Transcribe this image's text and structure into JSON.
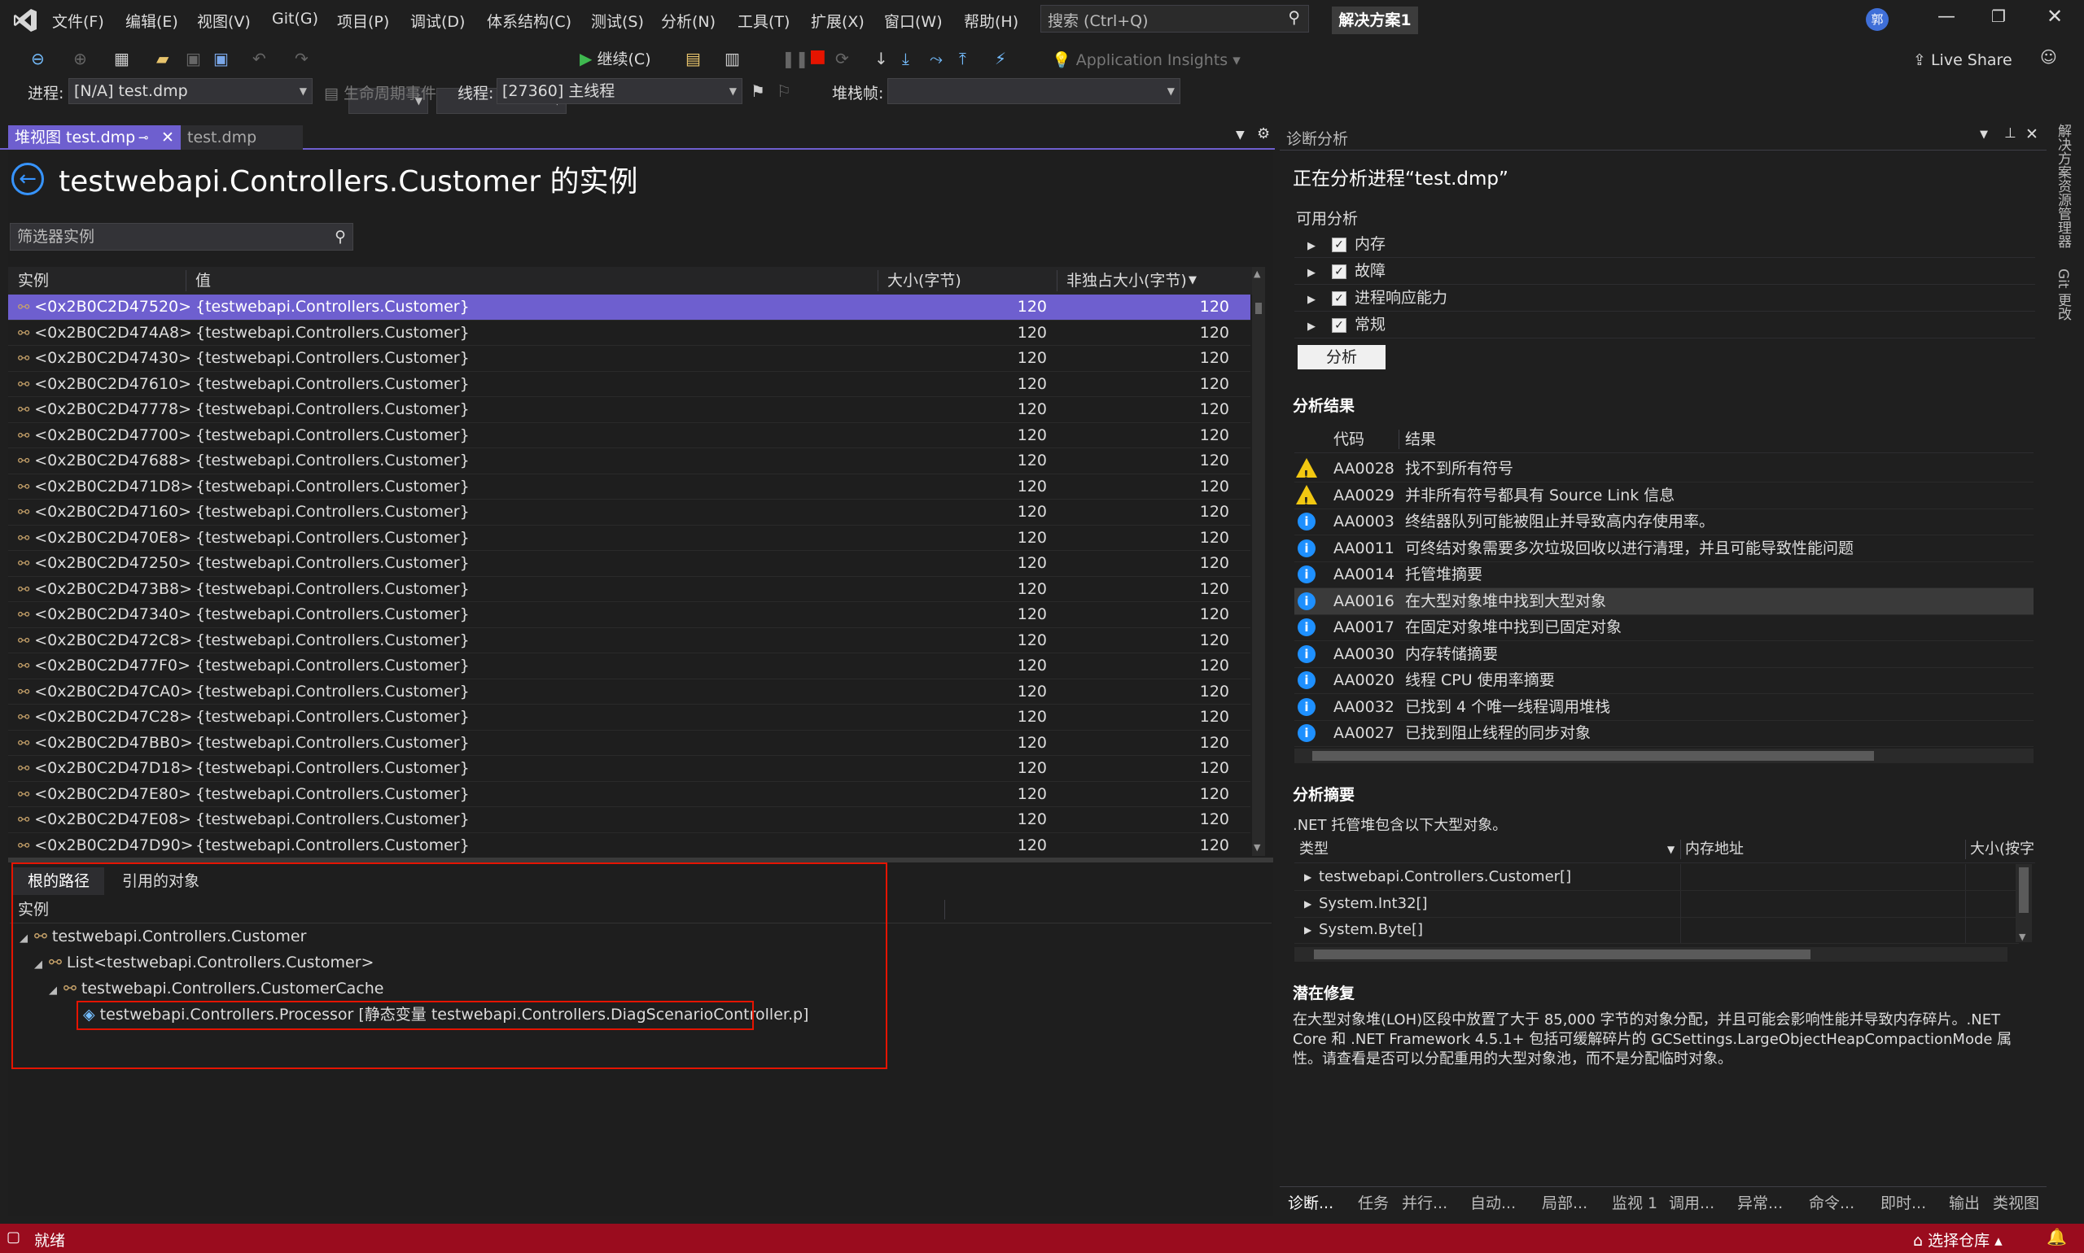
{
  "menu": [
    "文件(F)",
    "编辑(E)",
    "视图(V)",
    "Git(G)",
    "项目(P)",
    "调试(D)",
    "体系结构(C)",
    "测试(S)",
    "分析(N)",
    "工具(T)",
    "扩展(X)",
    "窗口(W)",
    "帮助(H)"
  ],
  "search": {
    "placeholder": "搜索 (Ctrl+Q)"
  },
  "solution_name": "解决方案1",
  "user_avatar": "郭",
  "toolbar": {
    "continue_label": "继续(C)",
    "app_insights": "Application Insights",
    "live_share": "Live Share"
  },
  "debug_location": {
    "process_label": "进程:",
    "process_value": "[N/A] test.dmp",
    "lifecycle_label": "生命周期事件",
    "thread_label": "线程:",
    "thread_value": "[27360] 主线程",
    "stack_label": "堆栈帧:"
  },
  "doc_tabs": [
    {
      "label": "堆视图 test.dmp",
      "active": true
    },
    {
      "label": "test.dmp",
      "active": false
    }
  ],
  "heap_view": {
    "title": "testwebapi.Controllers.Customer 的实例",
    "filter_placeholder": "筛选器实例",
    "columns": [
      "实例",
      "值",
      "大小(字节)",
      "非独占大小(字节)"
    ],
    "rows": [
      {
        "instance": "<0x2B0C2D47520>",
        "value": "{testwebapi.Controllers.Customer}",
        "size": "120",
        "inclusive": "120"
      },
      {
        "instance": "<0x2B0C2D474A8>",
        "value": "{testwebapi.Controllers.Customer}",
        "size": "120",
        "inclusive": "120"
      },
      {
        "instance": "<0x2B0C2D47430>",
        "value": "{testwebapi.Controllers.Customer}",
        "size": "120",
        "inclusive": "120"
      },
      {
        "instance": "<0x2B0C2D47610>",
        "value": "{testwebapi.Controllers.Customer}",
        "size": "120",
        "inclusive": "120"
      },
      {
        "instance": "<0x2B0C2D47778>",
        "value": "{testwebapi.Controllers.Customer}",
        "size": "120",
        "inclusive": "120"
      },
      {
        "instance": "<0x2B0C2D47700>",
        "value": "{testwebapi.Controllers.Customer}",
        "size": "120",
        "inclusive": "120"
      },
      {
        "instance": "<0x2B0C2D47688>",
        "value": "{testwebapi.Controllers.Customer}",
        "size": "120",
        "inclusive": "120"
      },
      {
        "instance": "<0x2B0C2D471D8>",
        "value": "{testwebapi.Controllers.Customer}",
        "size": "120",
        "inclusive": "120"
      },
      {
        "instance": "<0x2B0C2D47160>",
        "value": "{testwebapi.Controllers.Customer}",
        "size": "120",
        "inclusive": "120"
      },
      {
        "instance": "<0x2B0C2D470E8>",
        "value": "{testwebapi.Controllers.Customer}",
        "size": "120",
        "inclusive": "120"
      },
      {
        "instance": "<0x2B0C2D47250>",
        "value": "{testwebapi.Controllers.Customer}",
        "size": "120",
        "inclusive": "120"
      },
      {
        "instance": "<0x2B0C2D473B8>",
        "value": "{testwebapi.Controllers.Customer}",
        "size": "120",
        "inclusive": "120"
      },
      {
        "instance": "<0x2B0C2D47340>",
        "value": "{testwebapi.Controllers.Customer}",
        "size": "120",
        "inclusive": "120"
      },
      {
        "instance": "<0x2B0C2D472C8>",
        "value": "{testwebapi.Controllers.Customer}",
        "size": "120",
        "inclusive": "120"
      },
      {
        "instance": "<0x2B0C2D477F0>",
        "value": "{testwebapi.Controllers.Customer}",
        "size": "120",
        "inclusive": "120"
      },
      {
        "instance": "<0x2B0C2D47CA0>",
        "value": "{testwebapi.Controllers.Customer}",
        "size": "120",
        "inclusive": "120"
      },
      {
        "instance": "<0x2B0C2D47C28>",
        "value": "{testwebapi.Controllers.Customer}",
        "size": "120",
        "inclusive": "120"
      },
      {
        "instance": "<0x2B0C2D47BB0>",
        "value": "{testwebapi.Controllers.Customer}",
        "size": "120",
        "inclusive": "120"
      },
      {
        "instance": "<0x2B0C2D47D18>",
        "value": "{testwebapi.Controllers.Customer}",
        "size": "120",
        "inclusive": "120"
      },
      {
        "instance": "<0x2B0C2D47E80>",
        "value": "{testwebapi.Controllers.Customer}",
        "size": "120",
        "inclusive": "120"
      },
      {
        "instance": "<0x2B0C2D47E08>",
        "value": "{testwebapi.Controllers.Customer}",
        "size": "120",
        "inclusive": "120"
      },
      {
        "instance": "<0x2B0C2D47D90>",
        "value": "{testwebapi.Controllers.Customer}",
        "size": "120",
        "inclusive": "120"
      }
    ]
  },
  "root_panel": {
    "tabs": [
      "根的路径",
      "引用的对象"
    ],
    "column": "实例",
    "tree": [
      "testwebapi.Controllers.Customer",
      "List<testwebapi.Controllers.Customer>",
      "testwebapi.Controllers.CustomerCache",
      "testwebapi.Controllers.Processor [静态变量 testwebapi.Controllers.DiagScenarioController.p]"
    ]
  },
  "diagnostics": {
    "panel_title": "诊断分析",
    "analyzing": "正在分析进程“test.dmp”",
    "available_label": "可用分析",
    "analyses": [
      "内存",
      "故障",
      "进程响应能力",
      "常规"
    ],
    "analyze_button": "分析",
    "results_title": "分析结果",
    "results_columns": [
      "代码",
      "结果"
    ],
    "results": [
      {
        "level": "warn",
        "code": "AA0028",
        "text": "找不到所有符号"
      },
      {
        "level": "warn",
        "code": "AA0029",
        "text": "并非所有符号都具有 Source Link 信息"
      },
      {
        "level": "info",
        "code": "AA0003",
        "text": "终结器队列可能被阻止并导致高内存使用率。"
      },
      {
        "level": "info",
        "code": "AA0011",
        "text": "可终结对象需要多次垃圾回收以进行清理，并且可能导致性能问题"
      },
      {
        "level": "info",
        "code": "AA0014",
        "text": "托管堆摘要"
      },
      {
        "level": "info",
        "code": "AA0016",
        "text": "在大型对象堆中找到大型对象"
      },
      {
        "level": "info",
        "code": "AA0017",
        "text": "在固定对象堆中找到已固定对象"
      },
      {
        "level": "info",
        "code": "AA0030",
        "text": "内存转储摘要"
      },
      {
        "level": "info",
        "code": "AA0020",
        "text": "线程 CPU 使用率摘要"
      },
      {
        "level": "info",
        "code": "AA0032",
        "text": "已找到 4 个唯一线程调用堆栈"
      },
      {
        "level": "info",
        "code": "AA0027",
        "text": "已找到阻止线程的同步对象"
      }
    ],
    "summary_title": "分析摘要",
    "summary_text": ".NET 托管堆包含以下大型对象。",
    "summary_columns": [
      "类型",
      "内存地址",
      "大小(按字"
    ],
    "summary_rows": [
      "testwebapi.Controllers.Customer[]",
      "System.Int32[]",
      "System.Byte[]"
    ],
    "fix_title": "潜在修复",
    "fix_text": "在大型对象堆(LOH)区段中放置了大于 85,000 字节的对象分配，并且可能会影响性能并导致内存碎片。.NET Core 和 .NET Framework 4.5.1+ 包括可缓解碎片的 GCSettings.LargeObjectHeapCompactionMode 属性。请查看是否可以分配重用的大型对象池，而不是分配临时对象。"
  },
  "bottom_tabs": [
    "诊断...",
    "任务",
    "并行...",
    "自动...",
    "局部...",
    "监视 1",
    "调用...",
    "异常...",
    "命令...",
    "即时...",
    "输出",
    "类视图"
  ],
  "side_strip": [
    "解决方案资源管理器",
    "Git 更改"
  ],
  "status": {
    "ready": "就绪",
    "repo": "选择仓库"
  },
  "colors": {
    "accent": "#6e5fcf",
    "status_bar": "#9a0c1e",
    "highlight_box": "#e51400",
    "info": "#1e90ff",
    "warn": "#f2c811"
  }
}
